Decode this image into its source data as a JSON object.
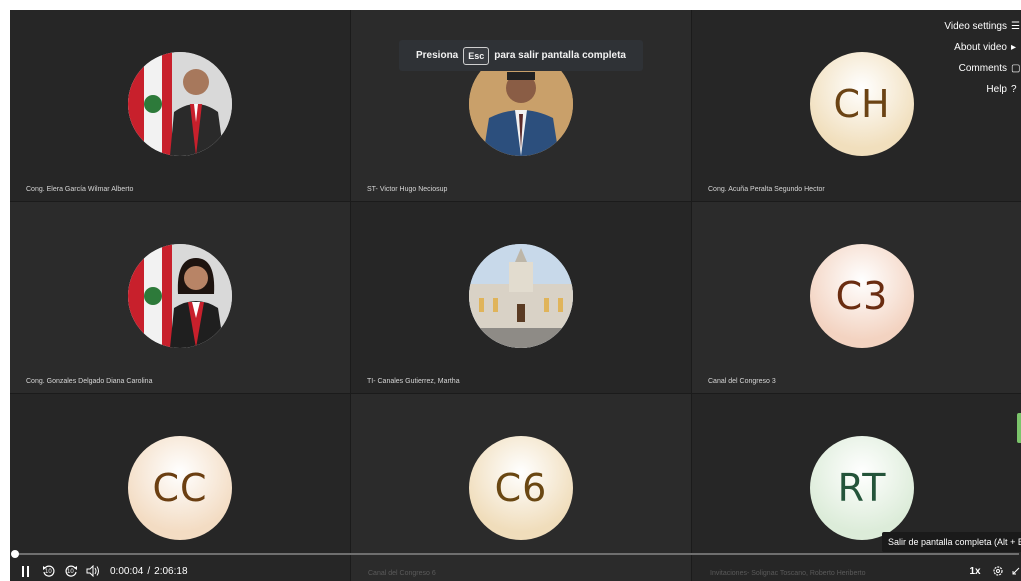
{
  "toast": {
    "before": "Presiona",
    "key": "Esc",
    "after": "para salir pantalla completa"
  },
  "menu": [
    {
      "label": "Video settings",
      "icon": "video-settings-icon"
    },
    {
      "label": "About video",
      "icon": "play-box-icon"
    },
    {
      "label": "Comments",
      "icon": "comment-icon"
    },
    {
      "label": "Help",
      "icon": "help-icon"
    }
  ],
  "tiles": [
    {
      "name": "Cong. Elera García Wilmar Alberto",
      "avatar": "photo-congressman-flag"
    },
    {
      "name": "ST- Victor Hugo Neciosup",
      "avatar": "photo-man-suit"
    },
    {
      "name": "Cong. Acuña Peralta Segundo Hector",
      "initials": "CH",
      "bg": "#f1dfbd",
      "fg": "#6b4314"
    },
    {
      "name": "Cong. Gonzales Delgado Diana Carolina",
      "avatar": "photo-congresswoman-flag"
    },
    {
      "name": "TI- Canales Gutierrez, Martha",
      "avatar": "photo-congress-building"
    },
    {
      "name": "Canal del Congreso 3",
      "initials": "C3",
      "bg": "#f3d3c1",
      "fg": "#6a2c10"
    },
    {
      "name": "",
      "initials": "CC",
      "bg": "#f3dcc3",
      "fg": "#6b3f12"
    },
    {
      "name": "",
      "initials": "C6",
      "bg": "#f0ddbb",
      "fg": "#6a4712"
    },
    {
      "name": "",
      "initials": "RT",
      "bg": "#dcecd9",
      "fg": "#24543a"
    }
  ],
  "partial_names": {
    "mid": "Canal del Congreso 6",
    "right": "Invitaciones- Solignac Toscano, Roberto Heriberto"
  },
  "player": {
    "current_time": "0:00:04",
    "separator": "/",
    "duration": "2:06:18",
    "skip_back": "10",
    "skip_forward": "10",
    "speed": "1x",
    "progress": 0.0005
  },
  "tooltip": "Salir de pantalla completa (Alt + Enter)"
}
